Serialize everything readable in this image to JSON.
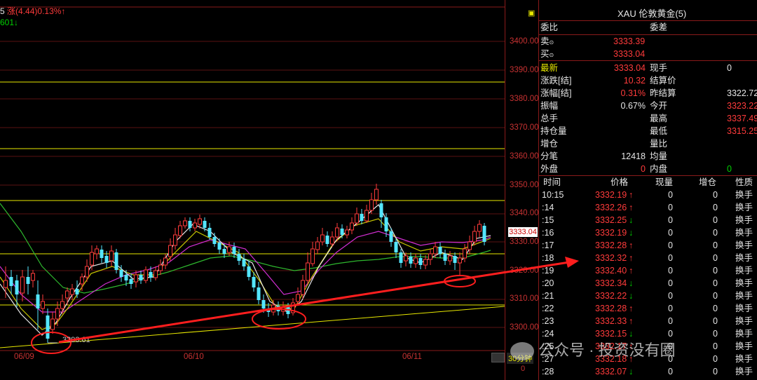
{
  "indicator_line": {
    "prefix": "5",
    "label": "涨(4.44)",
    "pct": "0.13%↑",
    "second": "601↓"
  },
  "price_axis": {
    "ticks": [
      "3400.00",
      "3390.00",
      "3380.00",
      "3370.00",
      "3360.00",
      "3350.00",
      "3340.00",
      "3330.00",
      "3320.00",
      "3310.00",
      "3300.00"
    ],
    "current_tag": "3333.04"
  },
  "x_axis": {
    "labels": [
      "06/09",
      "06/10",
      "06/11"
    ],
    "period_button": "30分钟",
    "bottom_value": "0"
  },
  "annotations": {
    "low_label": "3293.61"
  },
  "panel": {
    "title_marker": "▣",
    "title": "XAU 伦敦黄金(5)",
    "quote": {
      "weibi_label": "委比",
      "weicha_label": "委差",
      "sell_label": "卖",
      "sell_value": "3333.39",
      "buy_label": "买",
      "buy_value": "3333.04"
    },
    "stats_left": [
      {
        "label": "最新",
        "value": "3333.04",
        "label_color": "yellow",
        "value_color": "red"
      },
      {
        "label": "涨跌[结]",
        "value": "10.32",
        "label_color": "white",
        "value_color": "red"
      },
      {
        "label": "涨幅[结]",
        "value": "0.31%",
        "label_color": "white",
        "value_color": "red"
      },
      {
        "label": "振幅",
        "value": "0.67%",
        "label_color": "white",
        "value_color": "white"
      },
      {
        "label": "总手",
        "value": "",
        "label_color": "white",
        "value_color": "white"
      },
      {
        "label": "持仓量",
        "value": "",
        "label_color": "white",
        "value_color": "white"
      },
      {
        "label": "增仓",
        "value": "",
        "label_color": "white",
        "value_color": "white"
      },
      {
        "label": "分笔",
        "value": "12418",
        "label_color": "white",
        "value_color": "white"
      },
      {
        "label": "外盘",
        "value": "0",
        "label_color": "white",
        "value_color": "red"
      }
    ],
    "stats_right": [
      {
        "label": "现手",
        "value": "0",
        "value_color": "white"
      },
      {
        "label": "结算价",
        "value": "",
        "value_color": "white"
      },
      {
        "label": "昨结算",
        "value": "3322.72",
        "value_color": "white"
      },
      {
        "label": "今开",
        "value": "3323.22",
        "value_color": "red"
      },
      {
        "label": "最高",
        "value": "3337.49",
        "value_color": "red"
      },
      {
        "label": "最低",
        "value": "3315.25",
        "value_color": "red"
      },
      {
        "label": "量比",
        "value": "",
        "value_color": "white"
      },
      {
        "label": "均量",
        "value": "",
        "value_color": "white"
      },
      {
        "label": "内盘",
        "value": "0",
        "value_color": "green"
      }
    ],
    "ticks_header": [
      "时间",
      "价格",
      "现量",
      "增仓",
      "性质"
    ],
    "ticks": [
      {
        "time": "10:15",
        "price": "3332.19",
        "dir": "↑",
        "vol": "0",
        "add": "0",
        "nature": "换手"
      },
      {
        "time": ":14",
        "price": "3332.26",
        "dir": "↑",
        "vol": "0",
        "add": "0",
        "nature": "换手"
      },
      {
        "time": ":15",
        "price": "3332.25",
        "dir": "↓",
        "vol": "0",
        "add": "0",
        "nature": "换手"
      },
      {
        "time": ":16",
        "price": "3332.19",
        "dir": "↓",
        "vol": "0",
        "add": "0",
        "nature": "换手"
      },
      {
        "time": ":17",
        "price": "3332.28",
        "dir": "↑",
        "vol": "0",
        "add": "0",
        "nature": "换手"
      },
      {
        "time": ":18",
        "price": "3332.32",
        "dir": "↑",
        "vol": "0",
        "add": "0",
        "nature": "换手"
      },
      {
        "time": ":19",
        "price": "3332.40",
        "dir": "↑",
        "vol": "0",
        "add": "0",
        "nature": "换手"
      },
      {
        "time": ":20",
        "price": "3332.34",
        "dir": "↓",
        "vol": "0",
        "add": "0",
        "nature": "换手"
      },
      {
        "time": ":21",
        "price": "3332.22",
        "dir": "↓",
        "vol": "0",
        "add": "0",
        "nature": "换手"
      },
      {
        "time": ":22",
        "price": "3332.28",
        "dir": "↑",
        "vol": "0",
        "add": "0",
        "nature": "换手"
      },
      {
        "time": ":23",
        "price": "3332.33",
        "dir": "↑",
        "vol": "0",
        "add": "0",
        "nature": "换手"
      },
      {
        "time": ":24",
        "price": "3332.15",
        "dir": "↓",
        "vol": "0",
        "add": "0",
        "nature": "换手"
      },
      {
        "time": ":25",
        "price": "3332.17",
        "dir": "↑",
        "vol": "0",
        "add": "0",
        "nature": "换手"
      },
      {
        "time": ":27",
        "price": "3332.18",
        "dir": "↑",
        "vol": "0",
        "add": "0",
        "nature": "换手"
      },
      {
        "time": ":28",
        "price": "3332.07",
        "dir": "↓",
        "vol": "0",
        "add": "0",
        "nature": "换手"
      }
    ]
  },
  "watermark": "公众号 · 投资没有圈",
  "colors": {
    "up": "#ff3b3b",
    "down": "#00d000",
    "border": "#8a1a1a",
    "level_line": "#e8e800",
    "arrow": "#ff1e1e"
  }
}
